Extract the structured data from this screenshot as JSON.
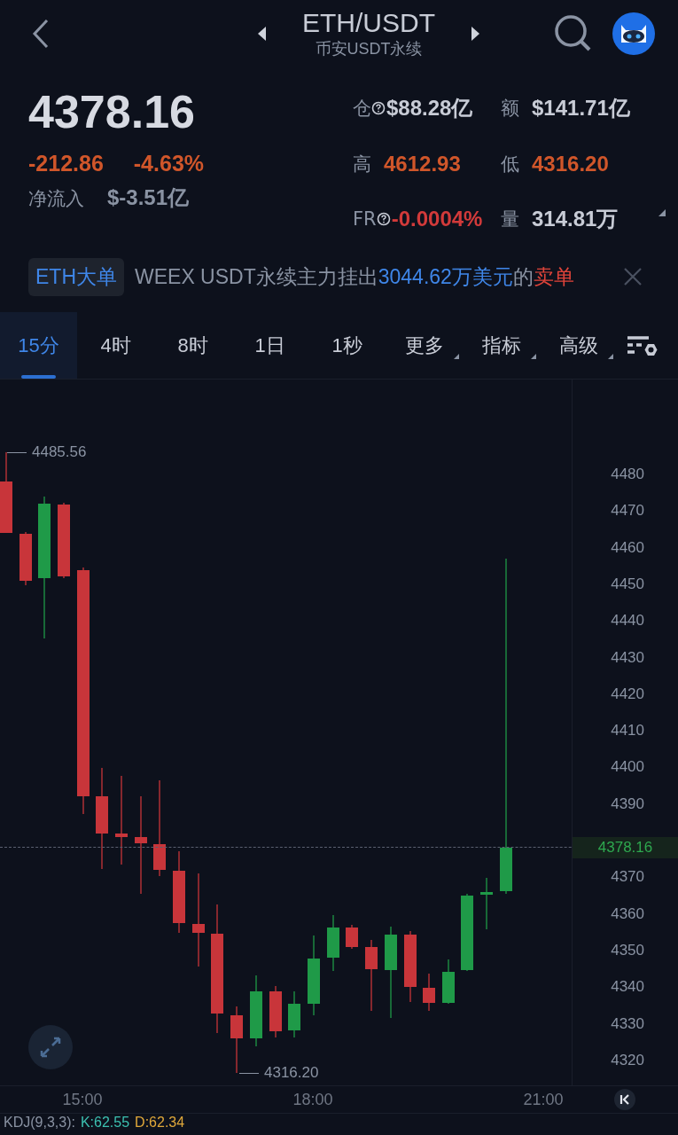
{
  "header": {
    "title": "ETH/USDT",
    "subtitle": "币安USDT永续"
  },
  "ticker": {
    "price": "4378.16",
    "change": "-212.86",
    "change_pct": "-4.63%",
    "net_inflow_label": "净流入",
    "net_inflow": "$-3.51亿",
    "stats": [
      {
        "label": "仓",
        "help": true,
        "value": "$88.28亿",
        "color": "#c8ccd6"
      },
      {
        "label": "额",
        "help": false,
        "value": "$141.71亿",
        "color": "#c8ccd6"
      },
      {
        "label": "高",
        "help": false,
        "value": "4612.93",
        "color": "#d0562a"
      },
      {
        "label": "低",
        "help": false,
        "value": "4316.20",
        "color": "#d0562a"
      },
      {
        "label": "FR",
        "help": true,
        "value": "-0.0004%",
        "color": "#d23a3a"
      },
      {
        "label": "量",
        "help": false,
        "value": "314.81万",
        "color": "#c8ccd6"
      }
    ]
  },
  "alert": {
    "tag": "ETH大单",
    "text": "WEEX USDT永续主力挂出",
    "amount": "3044.62万美元",
    "middle": "的",
    "side": "卖单"
  },
  "intervals": [
    {
      "label": "15分",
      "selected": true,
      "dropdown": false
    },
    {
      "label": "4时",
      "selected": false,
      "dropdown": false
    },
    {
      "label": "8时",
      "selected": false,
      "dropdown": false
    },
    {
      "label": "1日",
      "selected": false,
      "dropdown": false
    },
    {
      "label": "1秒",
      "selected": false,
      "dropdown": false
    },
    {
      "label": "更多",
      "selected": false,
      "dropdown": true
    },
    {
      "label": "指标",
      "selected": false,
      "dropdown": true
    },
    {
      "label": "高级",
      "selected": false,
      "dropdown": true
    }
  ],
  "chart": {
    "high_label": "4485.56",
    "low_label": "4316.20",
    "last_price": "4378.16",
    "y_axis": [
      "4480",
      "4470",
      "4460",
      "4450",
      "4440",
      "4430",
      "4420",
      "4410",
      "4400",
      "4390",
      "4370",
      "4360",
      "4350",
      "4340",
      "4330",
      "4320"
    ],
    "x_axis": [
      "15:00",
      "18:00",
      "21:00"
    ]
  },
  "indicator": {
    "name": "KDJ(9,3,3):",
    "k": "K:62.55",
    "d": "D:62.34"
  }
}
